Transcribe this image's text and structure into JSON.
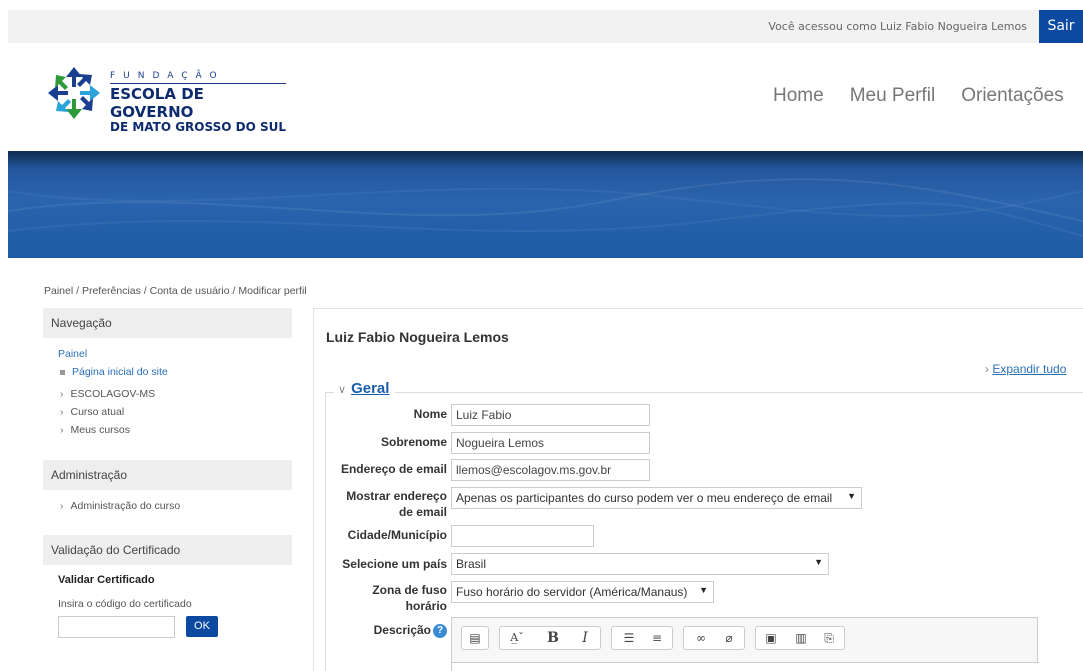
{
  "topbar": {
    "logged_in_text": "Você acessou como Luiz Fabio Nogueira Lemos",
    "logout_label": "Sair"
  },
  "logo": {
    "line1": "FUNDAÇÃO",
    "line2": "ESCOLA DE GOVERNO",
    "line3": "DE MATO GROSSO DO SUL"
  },
  "nav": {
    "items": [
      "Home",
      "Meu Perfil",
      "Orientações"
    ]
  },
  "breadcrumb": "Painel / Preferências / Conta de usuário / Modificar perfil",
  "sidebar": {
    "navigation": {
      "title": "Navegação",
      "root": "Painel",
      "items": [
        "Página inicial do site",
        "ESCOLAGOV-MS",
        "Curso atual",
        "Meus cursos"
      ]
    },
    "administration": {
      "title": "Administração",
      "items": [
        "Administração do curso"
      ]
    },
    "certificate": {
      "title": "Validação do Certificado",
      "subtitle": "Validar Certificado",
      "instruction": "Insira o código do certificado",
      "button_label": "OK"
    }
  },
  "main": {
    "title": "Luiz Fabio Nogueira Lemos",
    "expand_all": "Expandir tudo",
    "section_title": "Geral",
    "fields": {
      "name_label": "Nome",
      "name_value": "Luiz Fabio",
      "surname_label": "Sobrenome",
      "surname_value": "Nogueira Lemos",
      "email_label": "Endereço de email",
      "email_value": "llemos@escolagov.ms.gov.br",
      "show_email_label_1": "Mostrar endereço",
      "show_email_label_2": "de email",
      "show_email_value": "Apenas os participantes do curso podem ver o meu endereço de email",
      "city_label": "Cidade/Município",
      "city_value": "",
      "country_label": "Selecione um país",
      "country_value": "Brasil",
      "timezone_label_1": "Zona de fuso",
      "timezone_label_2": "horário",
      "timezone_value": "Fuso horário do servidor (América/Manaus)",
      "description_label": "Descrição"
    }
  },
  "colors": {
    "brand_blue": "#0b4aa0",
    "link_blue": "#2a6fb8"
  }
}
